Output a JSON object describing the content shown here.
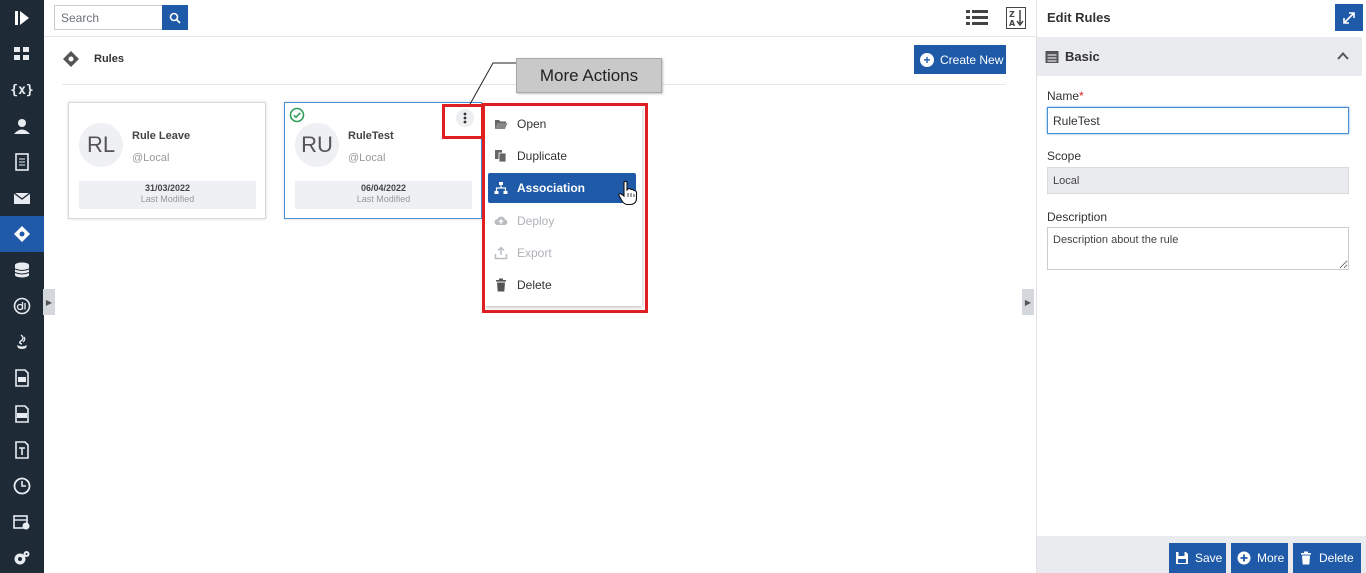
{
  "topbar": {
    "search_placeholder": "Search",
    "icons": [
      "search-icon",
      "list-view-icon",
      "sort-za-icon"
    ]
  },
  "rail": {
    "items": [
      "logo-icon",
      "dashboard-icon",
      "variables-icon",
      "user-icon",
      "document-icon",
      "mail-icon",
      "rules-icon",
      "database-icon",
      "datatype-icon",
      "java-icon",
      "file-icon",
      "csv-icon",
      "text-template-icon",
      "clock-icon",
      "calendar-settings-icon",
      "settings-icon"
    ],
    "variables_label": "{x}",
    "active": "rules-icon"
  },
  "breadcrumb": {
    "label": "Rules"
  },
  "create_button": {
    "label": "Create New"
  },
  "cards": [
    {
      "initials": "RL",
      "name": "Rule Leave",
      "scope": "@Local",
      "date": "31/03/2022",
      "date_label": "Last Modified"
    },
    {
      "initials": "RU",
      "name": "RuleTest",
      "scope": "@Local",
      "date": "06/04/2022",
      "date_label": "Last Modified"
    }
  ],
  "callout": {
    "text": "More Actions"
  },
  "menu": {
    "items": [
      {
        "label": "Open",
        "icon": "folder-open-icon",
        "state": "normal"
      },
      {
        "label": "Duplicate",
        "icon": "copy-icon",
        "state": "normal"
      },
      {
        "label": "Association",
        "icon": "sitemap-icon",
        "state": "active"
      },
      {
        "label": "Deploy",
        "icon": "cloud-upload-icon",
        "state": "disabled"
      },
      {
        "label": "Export",
        "icon": "export-icon",
        "state": "disabled"
      },
      {
        "label": "Delete",
        "icon": "trash-icon",
        "state": "normal"
      }
    ]
  },
  "edit_panel": {
    "title": "Edit Rules",
    "section": "Basic",
    "name_label": "Name",
    "required_mark": "*",
    "name_value": "RuleTest",
    "scope_label": "Scope",
    "scope_value": "Local",
    "description_label": "Description",
    "description_value": "Description about the rule",
    "buttons": {
      "save": "Save",
      "more": "More",
      "delete": "Delete"
    }
  },
  "colors": {
    "accent": "#1e5aa8",
    "rail": "#1f2a37",
    "highlight": "#e02020",
    "success": "#2e9e5b"
  }
}
